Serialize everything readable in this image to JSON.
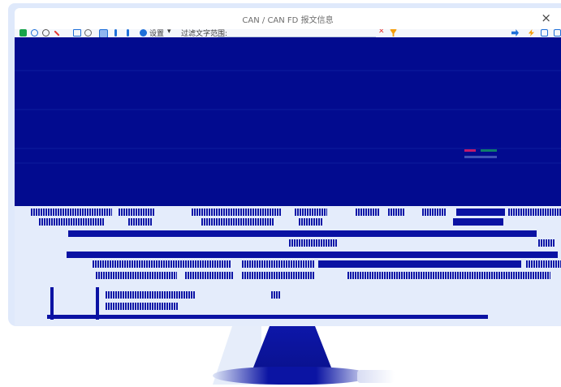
{
  "window": {
    "title": "CAN / CAN FD 报文信息",
    "close_glyph": "×"
  },
  "toolbar": {
    "settings_label": "设置",
    "dropdown_glyph": "▾",
    "filter_label": "过滤文字范围:",
    "clear_glyph": "✕",
    "icons": [
      "pause-icon",
      "record-icon",
      "refresh-icon",
      "stop-icon",
      "table-icon",
      "clock-icon",
      "view-icon",
      "download-icon",
      "upload-icon",
      "gear-icon",
      "filter-clear-icon",
      "funnel-icon",
      "tools-icon",
      "lightning-icon",
      "save-icon",
      "expand-icon"
    ]
  },
  "colors": {
    "band": "#020b8f",
    "ink": "#0a12a3",
    "background": "#dfe9fb",
    "accent_green": "#17a34a",
    "accent_red": "#e53935",
    "accent_blue": "#1e6fd9",
    "accent_orange": "#f59e0b"
  }
}
